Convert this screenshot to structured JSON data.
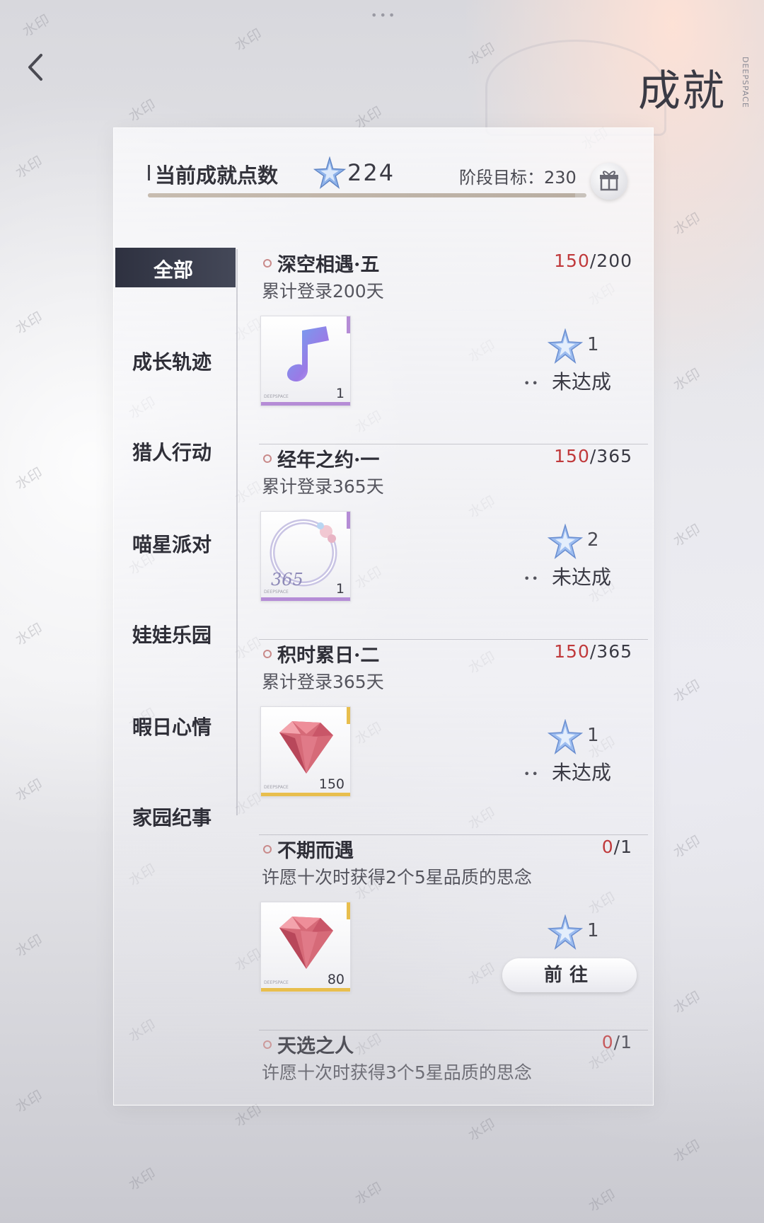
{
  "header": {
    "title": "成就",
    "brand": "DEEPSPACE",
    "top_dots": "•••"
  },
  "points": {
    "label": "当前成就点数",
    "value": "224",
    "goal_label": "阶段目标：",
    "goal_value": "230",
    "progress_fraction": 0.974
  },
  "sidebar": {
    "items": [
      {
        "label": "全部",
        "active": true
      },
      {
        "label": "成长轨迹"
      },
      {
        "label": "猎人行动"
      },
      {
        "label": "喵星派对"
      },
      {
        "label": "娃娃乐园"
      },
      {
        "label": "暇日心情"
      },
      {
        "label": "家园纪事"
      }
    ]
  },
  "achievements": [
    {
      "title": "深空相遇·五",
      "current": "150",
      "total": "/200",
      "desc": "累计登录200天",
      "reward_icon": "music-note-icon",
      "reward_qty": "1",
      "points": "1",
      "status": "未达成",
      "rarity_color": "#b58cd6"
    },
    {
      "title": "经年之约·一",
      "current": "150",
      "total": "/365",
      "desc": "累计登录365天",
      "reward_icon": "avatar-frame-icon",
      "reward_qty": "1",
      "points": "2",
      "status": "未达成",
      "rarity_color": "#b58cd6"
    },
    {
      "title": "积时累日·二",
      "current": "150",
      "total": "/365",
      "desc": "累计登录365天",
      "reward_icon": "diamond-icon",
      "reward_qty": "150",
      "points": "1",
      "status": "未达成",
      "rarity_color": "#e8be4d"
    },
    {
      "title": "不期而遇",
      "current": "0",
      "total": "/1",
      "desc": "许愿十次时获得2个5星品质的思念",
      "reward_icon": "diamond-icon",
      "reward_qty": "80",
      "points": "1",
      "button": "前往",
      "rarity_color": "#e8be4d"
    },
    {
      "title": "天选之人",
      "current": "0",
      "total": "/1",
      "desc": "许愿十次时获得3个5星品质的思念"
    }
  ],
  "watermark": "水印",
  "frame_text": "365",
  "reward_tag": "DEEPSPACE"
}
